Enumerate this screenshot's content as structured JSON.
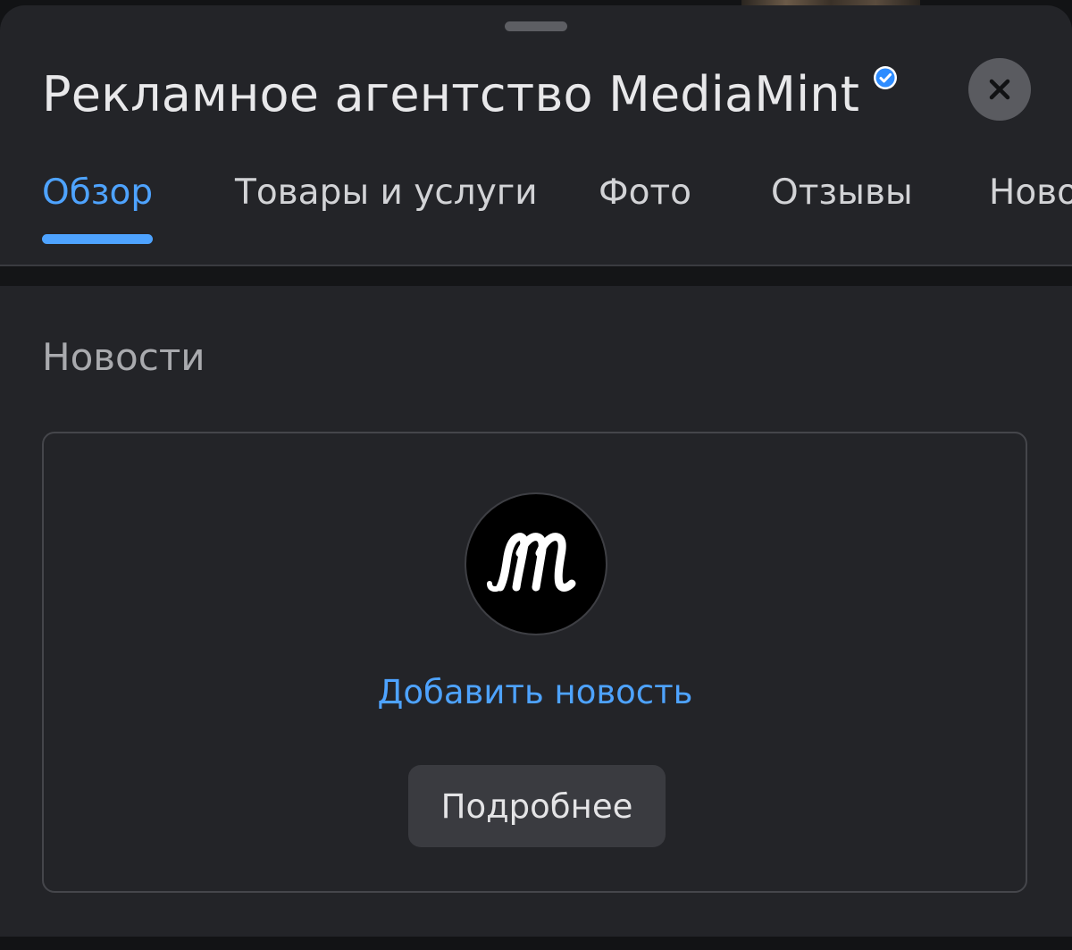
{
  "background_strip": {},
  "sheet": {
    "title": "Рекламное агентство MediaMint",
    "verified_icon": "verified-check-icon",
    "close_icon": "close-icon"
  },
  "tabs": [
    {
      "label": "Обзор",
      "active": true
    },
    {
      "label": "Товары и услуги",
      "active": false
    },
    {
      "label": "Фото",
      "active": false
    },
    {
      "label": "Отзывы",
      "active": false
    },
    {
      "label": "Новости",
      "active": false
    }
  ],
  "news": {
    "heading": "Новости",
    "logo_icon": "mediamint-logo",
    "add_label": "Добавить новость",
    "more_label": "Подробнее"
  },
  "colors": {
    "accent": "#4ea3ff",
    "sheet_bg": "#232428",
    "page_bg": "#121315",
    "button_bg": "#3a3b40"
  }
}
